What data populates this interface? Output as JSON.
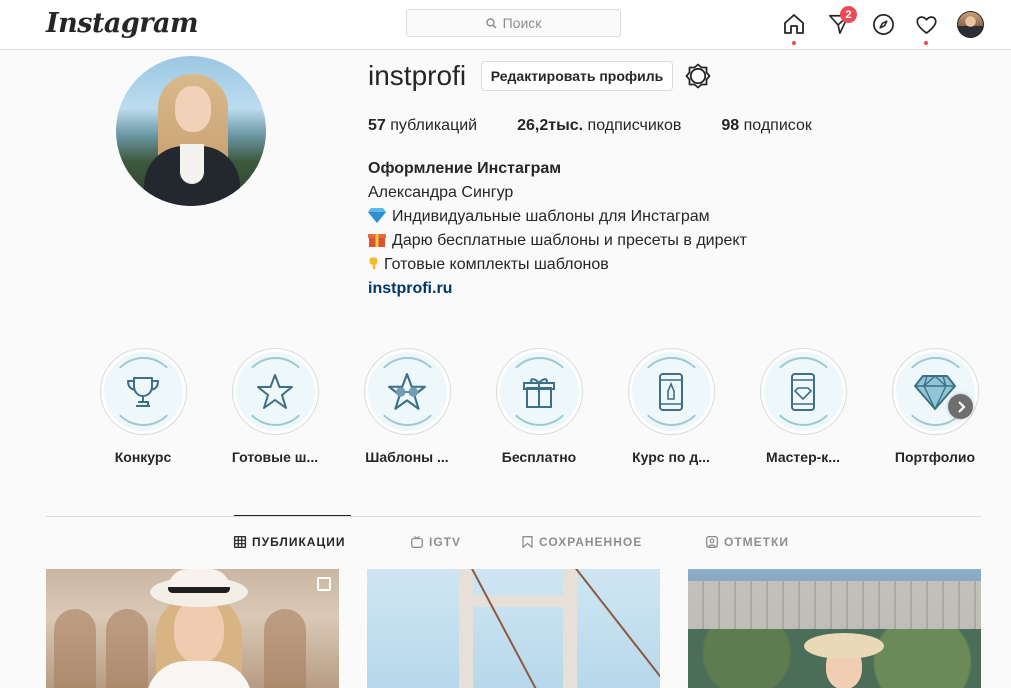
{
  "header": {
    "logo": "Instagram",
    "search_placeholder": "Поиск",
    "notification_count": "2"
  },
  "profile": {
    "username": "instprofi",
    "edit_button": "Редактировать профиль",
    "stats": {
      "posts_value": "57",
      "posts_label": "публикаций",
      "followers_value": "26,2тыс.",
      "followers_label": "подписчиков",
      "following_value": "98",
      "following_label": "подписок"
    },
    "bio": {
      "name": "Оформление Инстаграм",
      "line1": "Александра Сингур",
      "line2": "Индивидуальные шаблоны для Инстаграм",
      "line3": "Дарю бесплатные шаблоны и пресеты в директ",
      "line4": "Готовые комплекты шаблонов",
      "link": "instprofi.ru"
    }
  },
  "highlights": [
    {
      "label": "Конкурс",
      "icon": "trophy-icon"
    },
    {
      "label": "Готовые ш...",
      "icon": "star-icon"
    },
    {
      "label": "Шаблоны ...",
      "icon": "star-glasses-icon"
    },
    {
      "label": "Бесплатно",
      "icon": "gift-icon"
    },
    {
      "label": "Курс по д...",
      "icon": "phone-pen-icon"
    },
    {
      "label": "Мастер-к...",
      "icon": "phone-diamond-icon"
    },
    {
      "label": "Портфолио",
      "icon": "diamond-icon"
    }
  ],
  "tabs": {
    "posts": "ПУБЛИКАЦИИ",
    "igtv": "IGTV",
    "saved": "СОХРАНЕННОЕ",
    "tagged": "ОТМЕТКИ"
  },
  "colors": {
    "accent_red": "#ed4956",
    "link_blue": "#00376b",
    "highlight_teal": "#3d6f86"
  }
}
